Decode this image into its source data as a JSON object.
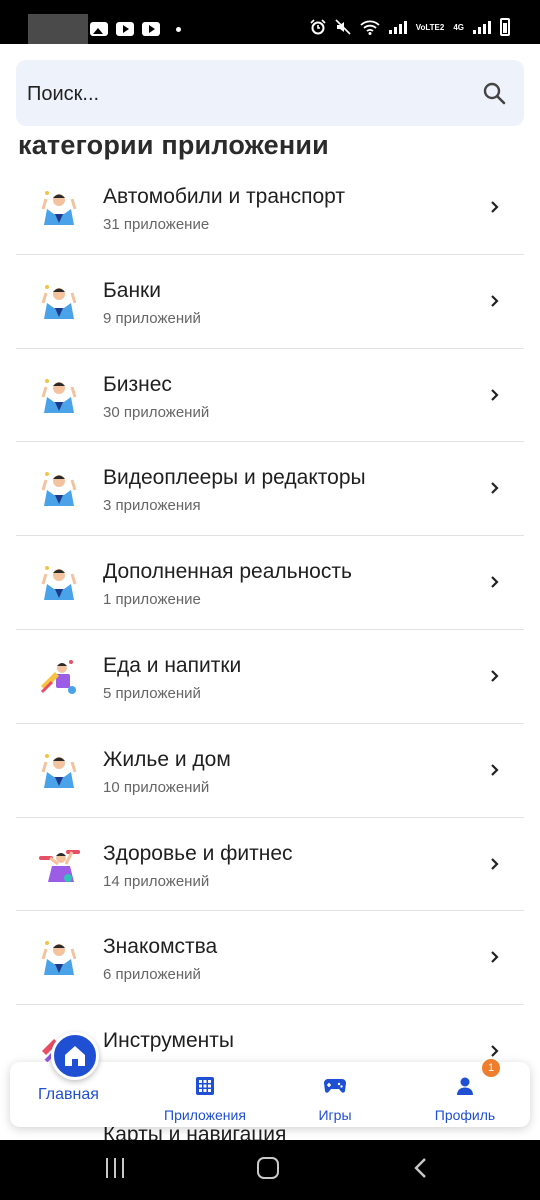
{
  "status_bar": {
    "network_label": "VoLTE2",
    "network_type": "4G"
  },
  "search": {
    "placeholder": "Поиск..."
  },
  "section_title": "категории приложении",
  "categories": [
    {
      "title": "Автомобили и транспорт",
      "count": "31 приложение",
      "icon": "person-celebrating-icon"
    },
    {
      "title": "Банки",
      "count": "9 приложений",
      "icon": "person-celebrating-icon"
    },
    {
      "title": "Бизнес",
      "count": "30 приложений",
      "icon": "person-celebrating-icon"
    },
    {
      "title": "Видеоплееры и редакторы",
      "count": "3 приложения",
      "icon": "person-celebrating-icon"
    },
    {
      "title": "Дополненная реальность",
      "count": "1 приложение",
      "icon": "person-celebrating-icon"
    },
    {
      "title": "Еда и напитки",
      "count": "5 приложений",
      "icon": "food-illustration-icon"
    },
    {
      "title": "Жилье и дом",
      "count": "10 приложений",
      "icon": "person-celebrating-icon"
    },
    {
      "title": "Здоровье и фитнес",
      "count": "14 приложений",
      "icon": "fitness-illustration-icon"
    },
    {
      "title": "Знакомства",
      "count": "6 приложений",
      "icon": "person-celebrating-icon"
    },
    {
      "title": "Инструменты",
      "count": "",
      "icon": "tools-illustration-icon"
    }
  ],
  "peek_item": "Карты и навигация",
  "bottom_nav": {
    "home_label": "Главная",
    "apps_label": "Приложения",
    "games_label": "Игры",
    "profile_label": "Профиль",
    "profile_badge": "1"
  },
  "colors": {
    "accent": "#1f4fd3",
    "search_bg": "#eef3fb",
    "badge": "#ef7d2e"
  }
}
